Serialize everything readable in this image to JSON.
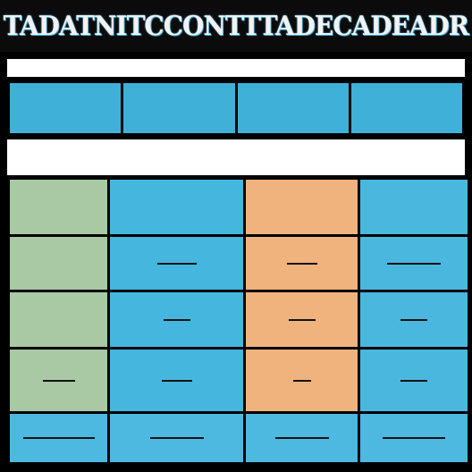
{
  "title": "TADATNITCCONTTTADECADEADR",
  "header_cells": [
    "",
    "",
    "",
    ""
  ],
  "columns": [
    {
      "heading": ""
    },
    {
      "heading": ""
    },
    {
      "heading": ""
    },
    {
      "heading": ""
    }
  ],
  "colors": {
    "background": "#000000",
    "header_blue": "#3fb0d8",
    "col_green": "#a9c9a4",
    "col_blue": "#45b7df",
    "col_orange": "#f0b37e",
    "white_band": "#ffffff"
  }
}
